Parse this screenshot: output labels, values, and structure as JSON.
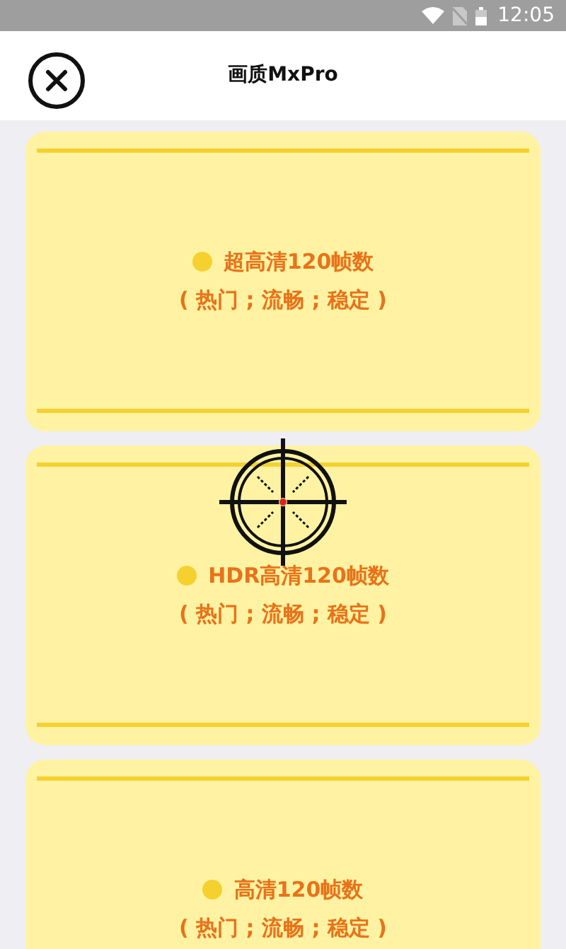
{
  "status_bar": {
    "time": "12:05"
  },
  "header": {
    "title": "画质MxPro"
  },
  "options": [
    {
      "title": "超高清120帧数",
      "subtitle": "( 热门 ; 流畅 ; 稳定 )"
    },
    {
      "title": "HDR高清120帧数",
      "subtitle": "( 热门 ; 流畅 ; 稳定 )"
    },
    {
      "title": "高清120帧数",
      "subtitle": "( 热门 ; 流畅 ; 稳定 )"
    }
  ]
}
